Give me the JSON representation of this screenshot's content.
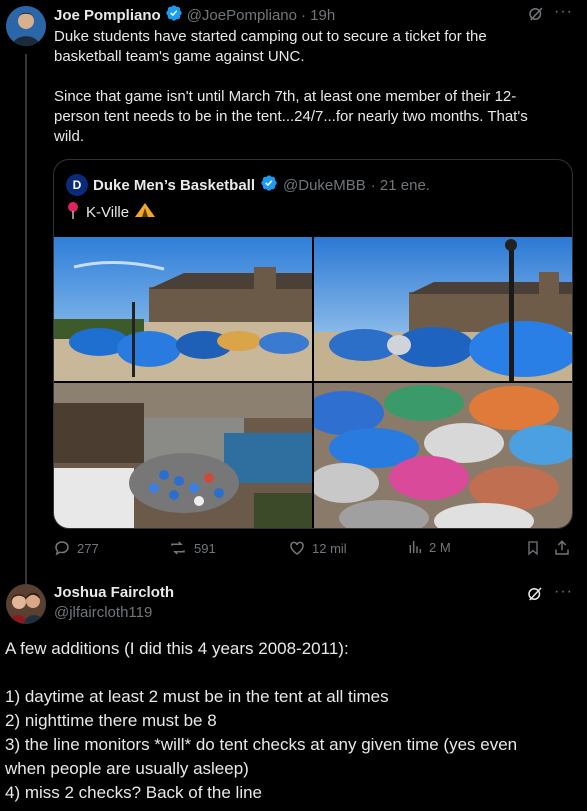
{
  "tweet1": {
    "display_name": "Joe Pompliano",
    "handle": "@JoePompliano",
    "time": "· 19h",
    "text_line1": "Duke students have started camping out to secure a ticket for the",
    "text_line2": "basketball team's game against UNC.",
    "text_line3": "Since that game isn't until March 7th, at least one member of their 12-",
    "text_line4": "person tent needs to be in the tent...24/7...for nearly two months. That's",
    "text_line5": "wild."
  },
  "quote": {
    "display_name": "Duke Men’s Basketball",
    "handle": "@DukeMBB",
    "time": "· 21 ene.",
    "text": "K-Ville"
  },
  "actions": {
    "replies": "277",
    "retweets": "591",
    "likes": "12 mil",
    "views": "2 M"
  },
  "tweet2": {
    "display_name": "Joshua Faircloth",
    "handle": "@jlfaircloth119",
    "line1": "A few additions (I did this 4 years 2008-2011):",
    "line2": "1) daytime at least 2 must be in the tent at all times",
    "line3": "2) nighttime there must be 8",
    "line4": "3) the line monitors *will* do tent checks at any given time (yes even",
    "line5": "when people are usually asleep)",
    "line6": "4) miss 2 checks? Back of the line"
  },
  "colors": {
    "verified": "#1d9bf0",
    "background": "#000000",
    "text": "#e7e9ea",
    "muted": "#71767b"
  }
}
